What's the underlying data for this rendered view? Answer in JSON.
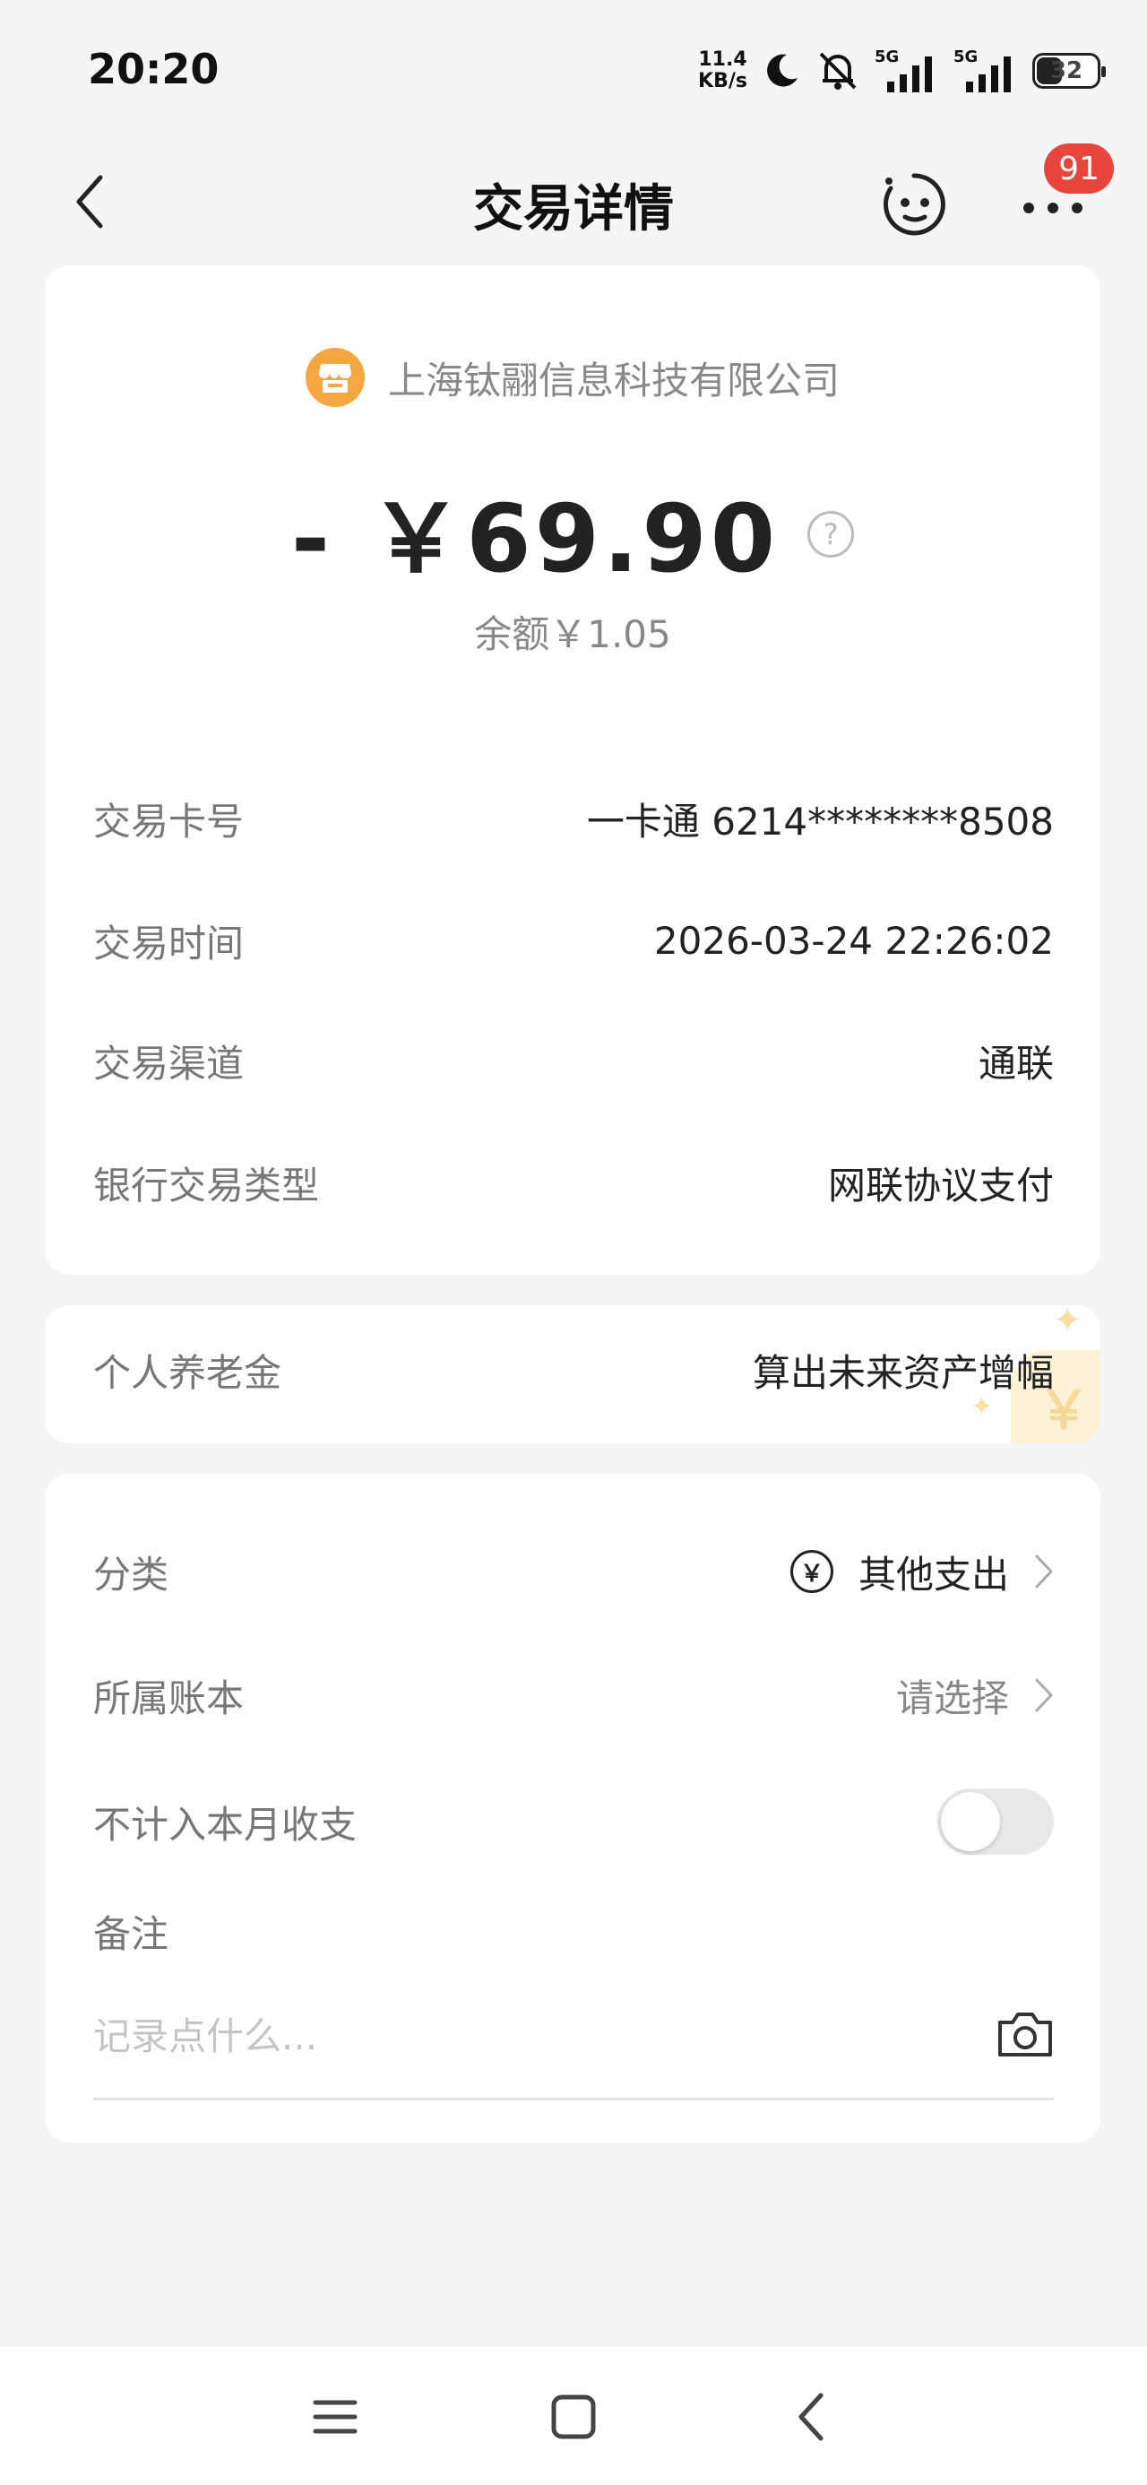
{
  "status_bar": {
    "time": "20:20",
    "net_speed_value": "11.4",
    "net_speed_unit": "KB/s",
    "signal1": "5G",
    "signal2": "5G",
    "battery": "32"
  },
  "nav": {
    "title": "交易详情",
    "badge_count": "91"
  },
  "transaction": {
    "merchant": "上海钛翮信息科技有限公司",
    "amount": "- ￥69.90",
    "help": "?",
    "balance": "余额￥1.05",
    "details": [
      {
        "label": "交易卡号",
        "value": "一卡通 6214********8508"
      },
      {
        "label": "交易时间",
        "value": "2026-03-24 22:26:02"
      },
      {
        "label": "交易渠道",
        "value": "通联"
      },
      {
        "label": "银行交易类型",
        "value": "网联协议支付"
      }
    ]
  },
  "pension": {
    "label": "个人养老金",
    "value": "算出未来资产增幅",
    "deco": "￥"
  },
  "settings": {
    "category_label": "分类",
    "category_icon": "￥",
    "category_value": "其他支出",
    "ledger_label": "所属账本",
    "ledger_value": "请选择",
    "exclude_label": "不计入本月收支",
    "exclude_on": false,
    "note_label": "备注",
    "note_placeholder": "记录点什么..."
  },
  "colors": {
    "accent_orange": "#f5a742",
    "badge_red": "#e8453c",
    "page_bg": "#f5f5f7"
  }
}
